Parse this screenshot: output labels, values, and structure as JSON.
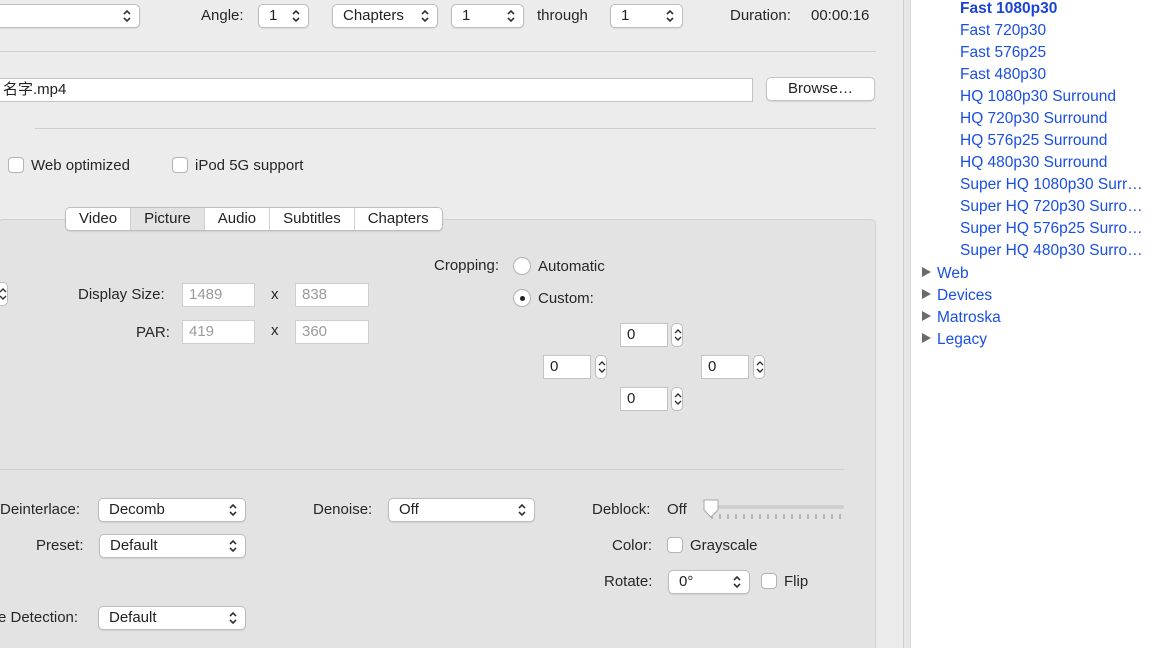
{
  "source_row": {
    "angle_label": "Angle:",
    "angle_value": "1",
    "range_type": "Chapters",
    "range_start": "1",
    "through_label": "through",
    "range_end": "1",
    "duration_label": "Duration:",
    "duration_value": "00:00:16"
  },
  "destination": {
    "file_value": "名字.mp4",
    "browse_label": "Browse…"
  },
  "options": {
    "web_optimized_label": "Web optimized",
    "web_optimized_checked": false,
    "ipod_label": "iPod 5G support",
    "ipod_checked": false
  },
  "tabs": [
    "Video",
    "Picture",
    "Audio",
    "Subtitles",
    "Chapters"
  ],
  "selected_tab": "Picture",
  "picture": {
    "display_size_label": "Display Size:",
    "display_width": "1489",
    "display_height": "838",
    "par_label": "PAR:",
    "par_width": "419",
    "par_height": "360",
    "x_sep": "x",
    "cropping_label": "Cropping:",
    "crop_automatic_label": "Automatic",
    "crop_custom_label": "Custom:",
    "crop_mode": "Custom",
    "crop_top": "0",
    "crop_left": "0",
    "crop_right": "0",
    "crop_bottom": "0"
  },
  "filters": {
    "deinterlace_label": "Deinterlace:",
    "deinterlace_value": "Decomb",
    "preset_label": "Preset:",
    "preset_value": "Default",
    "detection_label": "e Detection:",
    "detection_value": "Default",
    "denoise_label": "Denoise:",
    "denoise_value": "Off",
    "deblock_label": "Deblock:",
    "deblock_value": "Off",
    "color_label": "Color:",
    "grayscale_label": "Grayscale",
    "grayscale_checked": false,
    "rotate_label": "Rotate:",
    "rotate_value": "0°",
    "flip_label": "Flip",
    "flip_checked": false
  },
  "sidebar": {
    "presets": [
      "Fast 1080p30",
      "Fast 720p30",
      "Fast 576p25",
      "Fast 480p30",
      "HQ 1080p30 Surround",
      "HQ 720p30 Surround",
      "HQ 576p25 Surround",
      "HQ 480p30 Surround",
      "Super HQ 1080p30 Surr…",
      "Super HQ 720p30 Surro…",
      "Super HQ 576p25 Surro…",
      "Super HQ 480p30 Surro…"
    ],
    "selected_preset": "Fast 1080p30",
    "groups": [
      "Web",
      "Devices",
      "Matroska",
      "Legacy"
    ],
    "link_color": "#1a4fe0"
  }
}
